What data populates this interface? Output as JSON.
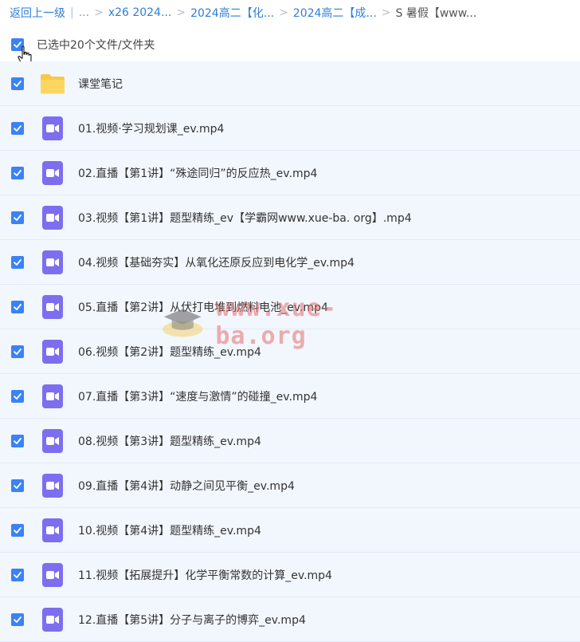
{
  "breadcrumb": {
    "back": "返回上一级",
    "ellipsis": "...",
    "items": [
      "x26 2024...",
      "2024高二【化...",
      "2024高二【成..."
    ],
    "current": "S 暑假【www..."
  },
  "selection": {
    "label": "已选中20个文件/文件夹"
  },
  "files": [
    {
      "name": "课堂笔记",
      "type": "folder"
    },
    {
      "name": "01.视频·学习规划课_ev.mp4",
      "type": "video"
    },
    {
      "name": "02.直播【第1讲】“殊途同归”的反应热_ev.mp4",
      "type": "video"
    },
    {
      "name": "03.视频【第1讲】题型精练_ev【学霸网www.xue-ba. org】.mp4",
      "type": "video"
    },
    {
      "name": "04.视频【基础夯实】从氧化还原反应到电化学_ev.mp4",
      "type": "video"
    },
    {
      "name": "05.直播【第2讲】从伏打电堆到燃料电池_ev.mp4",
      "type": "video"
    },
    {
      "name": "06.视频【第2讲】题型精练_ev.mp4",
      "type": "video"
    },
    {
      "name": "07.直播【第3讲】“速度与激情”的碰撞_ev.mp4",
      "type": "video"
    },
    {
      "name": "08.视频【第3讲】题型精练_ev.mp4",
      "type": "video"
    },
    {
      "name": "09.直播【第4讲】动静之间见平衡_ev.mp4",
      "type": "video"
    },
    {
      "name": "10.视频【第4讲】题型精练_ev.mp4",
      "type": "video"
    },
    {
      "name": "11.视频【拓展提升】化学平衡常数的计算_ev.mp4",
      "type": "video"
    },
    {
      "name": "12.直播【第5讲】分子与离子的博弈_ev.mp4",
      "type": "video"
    }
  ],
  "watermark": {
    "text": "www.xue-ba.org"
  },
  "colors": {
    "accent": "#3b82f6",
    "row_bg": "#f2f7fd",
    "video_icon": "#7d6ef0",
    "folder": "#f7c94b",
    "link": "#2f7fd8"
  }
}
